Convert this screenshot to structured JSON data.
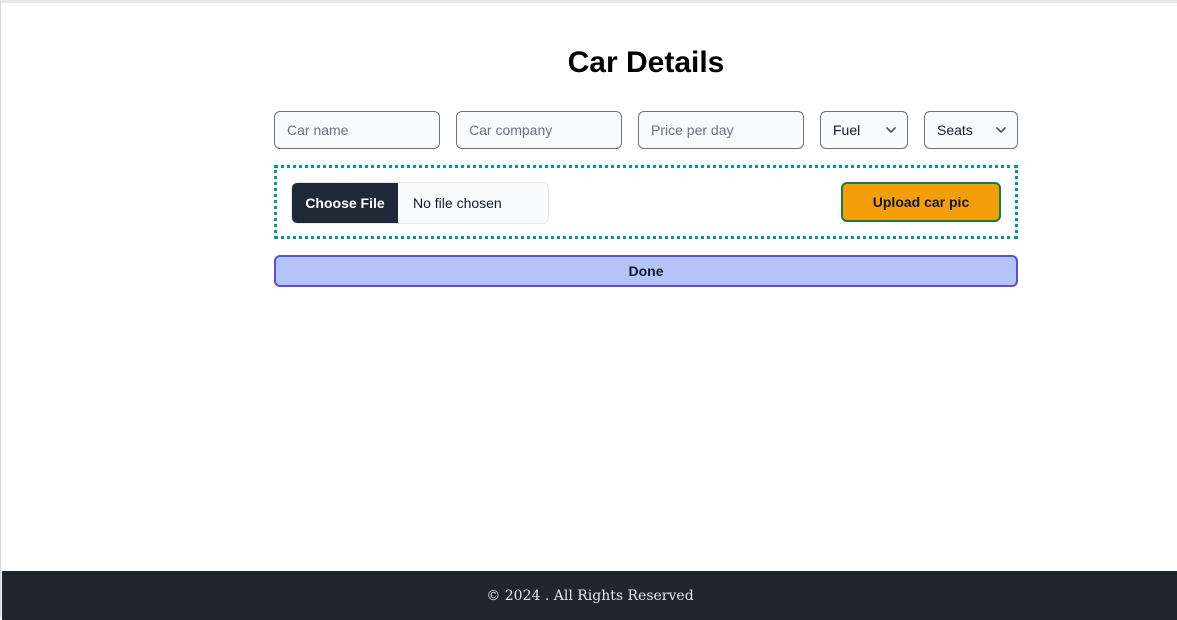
{
  "page": {
    "title": "Car Details"
  },
  "form": {
    "car_name": {
      "placeholder": "Car name",
      "value": ""
    },
    "car_company": {
      "placeholder": "Car company",
      "value": ""
    },
    "price_per_day": {
      "placeholder": "Price per day",
      "value": ""
    },
    "fuel": {
      "selected": "Fuel"
    },
    "seats": {
      "selected": "Seats"
    }
  },
  "upload": {
    "choose_file_label": "Choose File",
    "file_status": "No file chosen",
    "upload_button_label": "Upload car pic"
  },
  "actions": {
    "done_label": "Done"
  },
  "footer": {
    "copyright": "© 2024 . All Rights Reserved"
  },
  "colors": {
    "upload_border": "#0d9488",
    "upload_button": "#f59e0b",
    "done_button": "#b4c3f8",
    "done_border": "#5b4fd1",
    "footer_bg": "#1f262d",
    "file_button": "#1f2937"
  },
  "icons": {
    "select_arrow": "chevron-down-icon"
  }
}
